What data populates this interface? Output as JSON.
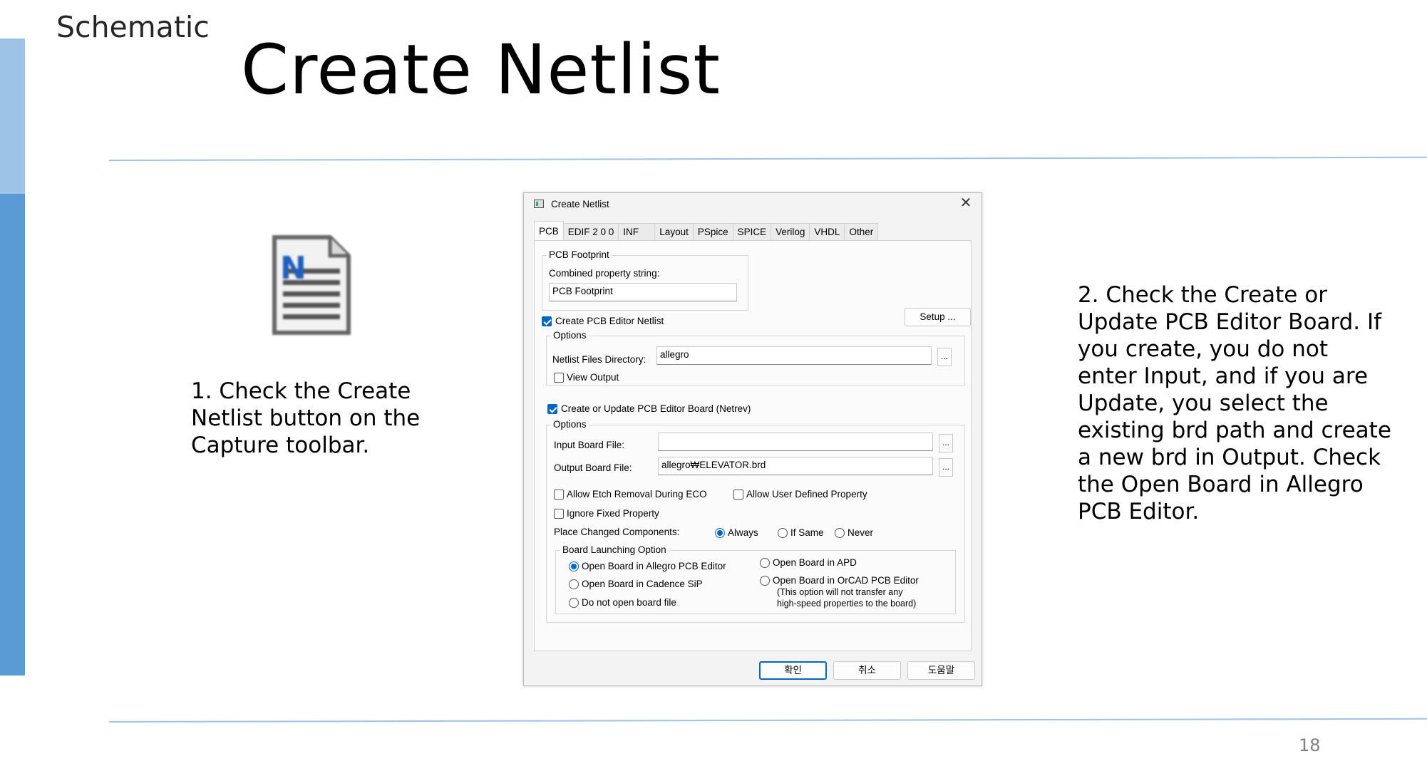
{
  "slide": {
    "section_label": "Schematic",
    "title": "Create Netlist",
    "page_number": "18",
    "step1": "1. Check the Create Netlist button on the Capture toolbar.",
    "step2": "2. Check the Create or Update PCB Editor Board. If you create, you do not enter Input, and if you are Update, you select the existing brd path and create a new brd in Output. Check the Open Board in Allegro PCB Editor.",
    "icon": "netlist-document-icon",
    "accent_light": "#9dc3e6",
    "accent_dark": "#5b9bd5"
  },
  "dialog": {
    "title": "Create Netlist",
    "close": "✕",
    "tabs": [
      {
        "label": "PCB"
      },
      {
        "label": "EDIF 2 0 0"
      },
      {
        "label": "INF"
      },
      {
        "label": "Layout"
      },
      {
        "label": "PSpice"
      },
      {
        "label": "SPICE"
      },
      {
        "label": "Verilog"
      },
      {
        "label": "VHDL"
      },
      {
        "label": "Other"
      }
    ],
    "footprint": {
      "legend": "PCB Footprint",
      "label": "Combined property string:",
      "value": "PCB Footprint"
    },
    "setup_button": "Setup ...",
    "create_netlist": {
      "label": "Create PCB Editor Netlist",
      "checked": true
    },
    "options1": {
      "legend": "Options",
      "dir_label": "Netlist Files Directory:",
      "dir_value": "allegro",
      "browse": "...",
      "view_output": {
        "label": "View Output",
        "checked": false
      }
    },
    "create_board": {
      "label": "Create or Update PCB Editor Board (Netrev)",
      "checked": true
    },
    "options2": {
      "legend": "Options",
      "input_label": "Input Board File:",
      "input_value": "",
      "output_label": "Output Board File:",
      "output_value": "allegro₩ELEVATOR.brd",
      "browse": "...",
      "allow_etch": {
        "label": "Allow Etch Removal During ECO",
        "checked": false
      },
      "allow_user": {
        "label": "Allow User Defined Property",
        "checked": false
      },
      "ignore_fixed": {
        "label": "Ignore Fixed Property",
        "checked": false
      },
      "place_label": "Place Changed Components:",
      "place_options": [
        {
          "label": "Always",
          "checked": true
        },
        {
          "label": "If Same",
          "checked": false
        },
        {
          "label": "Never",
          "checked": false
        }
      ]
    },
    "launch": {
      "legend": "Board Launching Option",
      "options": [
        {
          "label": "Open Board in Allegro PCB Editor",
          "checked": true
        },
        {
          "label": "Open Board in Cadence SiP",
          "checked": false
        },
        {
          "label": "Do not open board file",
          "checked": false
        },
        {
          "label": "Open Board in APD",
          "checked": false
        },
        {
          "label": "Open Board in OrCAD PCB Editor",
          "checked": false
        }
      ],
      "note_line1": "(This option will not transfer any",
      "note_line2": "high-speed properties to the board)"
    },
    "buttons": {
      "ok": "확인",
      "cancel": "취소",
      "help": "도움말"
    },
    "accent": "#0067c0"
  }
}
